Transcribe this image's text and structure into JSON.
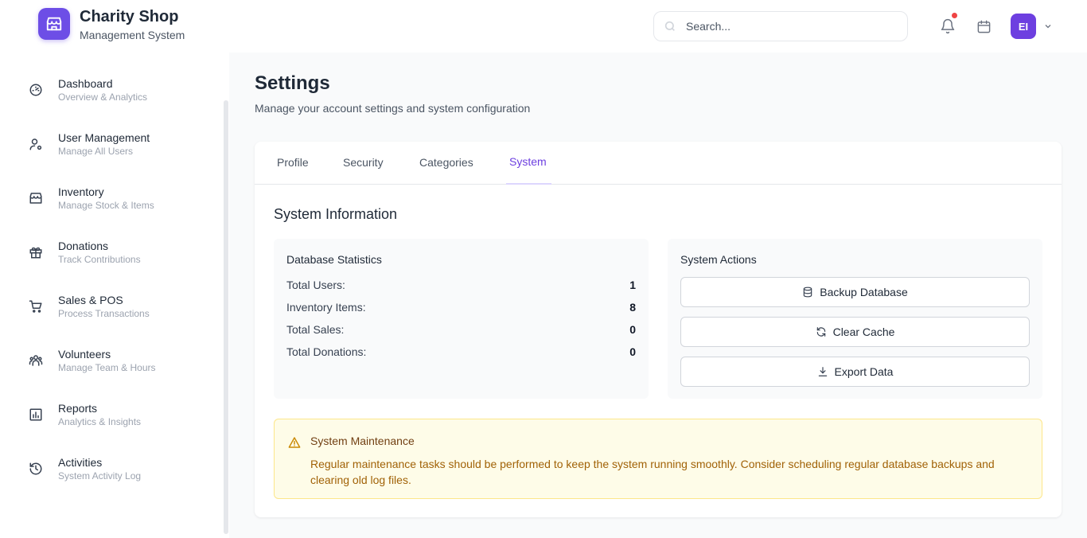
{
  "app": {
    "title": "Charity Shop",
    "subtitle": "Management System"
  },
  "header": {
    "search_placeholder": "Search...",
    "avatar_initials": "EI",
    "notification_color": "#ef4444"
  },
  "sidebar": {
    "items": [
      {
        "label": "Dashboard",
        "sub": "Overview & Analytics",
        "icon": "gauge-icon"
      },
      {
        "label": "User Management",
        "sub": "Manage All Users",
        "icon": "user-gear-icon"
      },
      {
        "label": "Inventory",
        "sub": "Manage Stock & Items",
        "icon": "store-icon"
      },
      {
        "label": "Donations",
        "sub": "Track Contributions",
        "icon": "gift-icon"
      },
      {
        "label": "Sales & POS",
        "sub": "Process Transactions",
        "icon": "cart-icon"
      },
      {
        "label": "Volunteers",
        "sub": "Manage Team & Hours",
        "icon": "team-icon"
      },
      {
        "label": "Reports",
        "sub": "Analytics & Insights",
        "icon": "bar-chart-icon"
      },
      {
        "label": "Activities",
        "sub": "System Activity Log",
        "icon": "history-icon"
      }
    ]
  },
  "main": {
    "title": "Settings",
    "description": "Manage your account settings and system configuration",
    "tabs": [
      {
        "label": "Profile"
      },
      {
        "label": "Security"
      },
      {
        "label": "Categories"
      },
      {
        "label": "System",
        "active": true
      }
    ],
    "section_title": "System Information",
    "db_stats": {
      "title": "Database Statistics",
      "rows": [
        {
          "label": "Total Users:",
          "value": "1"
        },
        {
          "label": "Inventory Items:",
          "value": "8"
        },
        {
          "label": "Total Sales:",
          "value": "0"
        },
        {
          "label": "Total Donations:",
          "value": "0"
        }
      ]
    },
    "actions": {
      "title": "System Actions",
      "backup": "Backup Database",
      "clear_cache": "Clear Cache",
      "export": "Export Data"
    },
    "alert": {
      "title": "System Maintenance",
      "text": "Regular maintenance tasks should be performed to keep the system running smoothly. Consider scheduling regular database backups and clearing old log files."
    }
  },
  "colors": {
    "accent": "#6d3fe0",
    "warning_bg": "#fefce8",
    "warning_text": "#a16207"
  }
}
